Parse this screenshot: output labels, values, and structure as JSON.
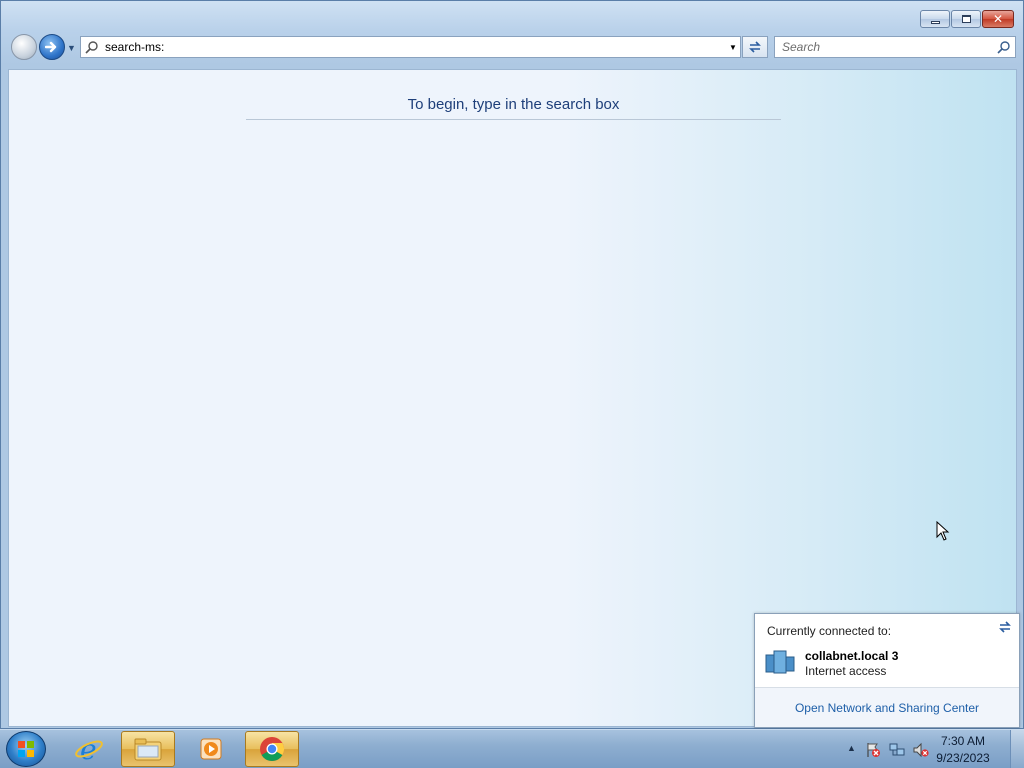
{
  "window": {
    "minimize_icon": "minimize-icon",
    "maximize_icon": "restore-icon",
    "close_icon": "close-icon"
  },
  "navbar": {
    "address_value": "search-ms:",
    "search_placeholder": "Search"
  },
  "content": {
    "empty_message": "To begin, type in the search box"
  },
  "flyout": {
    "header": "Currently connected to:",
    "network_name": "collabnet.local  3",
    "network_status": "Internet access",
    "link": "Open Network and Sharing Center"
  },
  "taskbar": {
    "items": [
      {
        "name": "internet-explorer",
        "icon": "ie-icon"
      },
      {
        "name": "windows-explorer",
        "icon": "folder-icon"
      },
      {
        "name": "media-player",
        "icon": "media-player-icon"
      },
      {
        "name": "chrome",
        "icon": "chrome-icon"
      }
    ],
    "clock_time": "7:30 AM",
    "clock_date": "9/23/2023"
  },
  "colors": {
    "accent": "#1e5fa8",
    "heading": "#1e3f7a",
    "taskbar": "#8eaed0"
  }
}
